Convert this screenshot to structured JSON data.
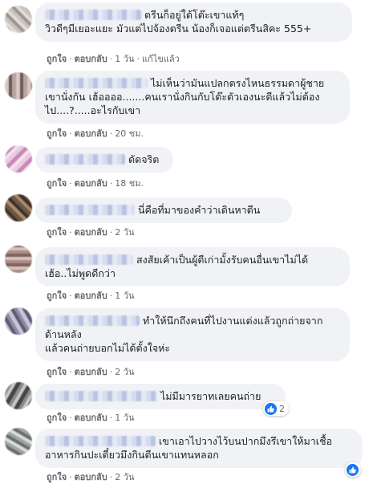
{
  "labels": {
    "like": "ถูกใจ",
    "reply": "ตอบกลับ",
    "separator": "·"
  },
  "comments": [
    {
      "text": "ตรีนก็อยู่ใต้โต๊ะเขาแท้ๆ\nวิวดีๆมีเยอะแยะ มัวแต่ไปจ้องตรีน น้องก็เจอแต่ตรีนสิคะ 555+",
      "time": "1 วัน",
      "edited": "แก้ไขแล้ว",
      "reactions": ""
    },
    {
      "text": "ไม่เห็นว่ามันแปลกตรงไหนธรรมดาผู้ชายเขานั่งกัน เฮ้ออออ.......คนเรานั่งกินกับโต๊ะตัวเองนะดีแล้วไม่ต้องไป....?.....อะไรกับเขา",
      "time": "20 ชม.",
      "edited": "",
      "reactions": ""
    },
    {
      "text": "ดัดจริต",
      "time": "18 ชม.",
      "edited": "",
      "reactions": ""
    },
    {
      "text": "นี่คือที่มาของคำว่าเดินหาตีน",
      "time": "2 วัน",
      "edited": "",
      "reactions": ""
    },
    {
      "text": "สงสัยเค้าเป็นผู้ดีเก่ามั้งรับคนอื่นเขาไม่ได้ เฮ้อ..ไม่พูดดีกว่า",
      "time": "1 วัน",
      "edited": "",
      "reactions": ""
    },
    {
      "text": "ทำให้นึกถึงคนที่ไปงานแต่งแล้วถูกถ่ายจากด้านหลัง\nแล้วคนถ่ายบอกไม่ได้ตั้งใจห่ะ",
      "time": "2 วัน",
      "edited": "",
      "reactions": ""
    },
    {
      "text": "ไม่มีมารยาทเลยคนถ่าย",
      "time": "1 วัน",
      "edited": "",
      "reactions": "2"
    },
    {
      "text": "เขาเอาไปวางไว้บนปากมึงรึเขาให้มาเชื้ออาหารกินปะเดี๋ยวมึงกินตีนเขาแทนหลอก",
      "time": "2 วัน",
      "edited": "",
      "reactions": ""
    }
  ]
}
